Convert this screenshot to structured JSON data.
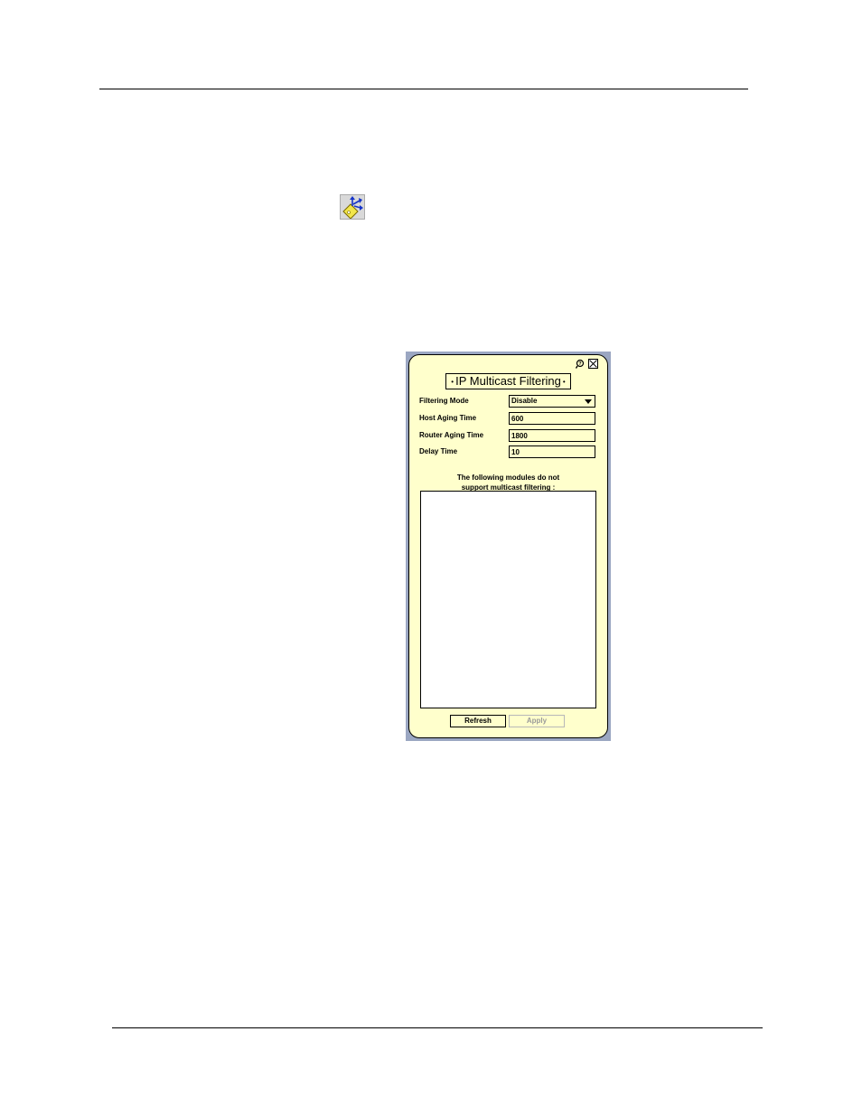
{
  "panel": {
    "title": "IP Multicast Filtering",
    "title_bullet": "•",
    "fields": {
      "filtering_mode": {
        "label": "Filtering Mode",
        "value": "Disable"
      },
      "host_aging_time": {
        "label": "Host Aging Time",
        "value": "600"
      },
      "router_aging_time": {
        "label": "Router Aging Time",
        "value": "1800"
      },
      "delay_time": {
        "label": "Delay Time",
        "value": "10"
      }
    },
    "note_line1": "The following modules do not",
    "note_line2": "support multicast filtering :",
    "modules": [],
    "buttons": {
      "refresh": "Refresh",
      "apply": "Apply"
    }
  },
  "colors": {
    "panel_bg": "#ffffcc",
    "frame_bg": "#9ba7c2",
    "disabled_text": "#9a9a9a"
  },
  "icons": {
    "toolbar": "multicast-filter-icon",
    "panel_help": "help-icon",
    "panel_close": "close-icon"
  }
}
